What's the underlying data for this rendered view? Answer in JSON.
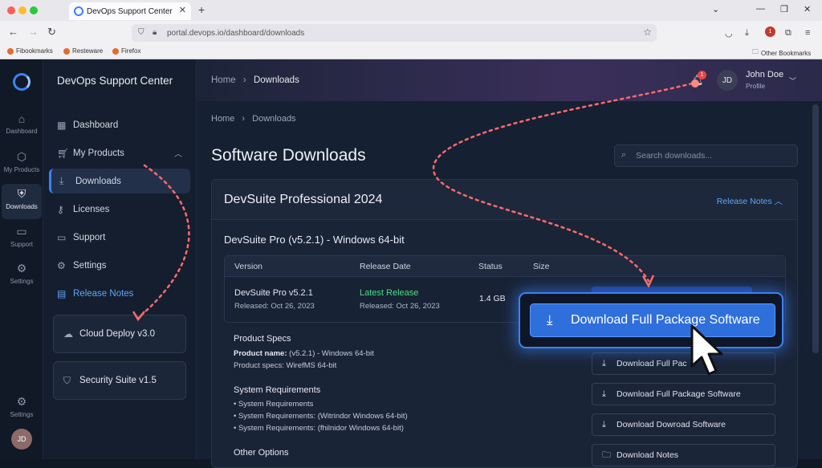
{
  "browser": {
    "tab_title": "DevOps Support Center",
    "url": "portal.devops.io/dashboard/downloads",
    "bookmarks": [
      "Fibookmarks",
      "Resteware",
      "Firefox"
    ],
    "other_bookmarks": "Other Bookmarks",
    "notif_count": "1"
  },
  "rail": {
    "items": [
      {
        "label": "Dashboard",
        "icon": "home-icon"
      },
      {
        "label": "My Products",
        "icon": "box-icon"
      },
      {
        "label": "Downloads",
        "icon": "shield-icon"
      },
      {
        "label": "Support",
        "icon": "chat-icon"
      },
      {
        "label": "Settings",
        "icon": "gear-icon"
      }
    ],
    "bottom_settings": "Settings",
    "avatar": "JD"
  },
  "sidebar": {
    "title": "DevOps Support Center",
    "items": [
      {
        "label": "Dashboard",
        "icon": "grid-icon"
      },
      {
        "label": "My Products",
        "icon": "cart-icon"
      },
      {
        "label": "Downloads",
        "icon": "download-icon"
      },
      {
        "label": "Licenses",
        "icon": "key-icon"
      },
      {
        "label": "Support",
        "icon": "chat-icon"
      },
      {
        "label": "Settings",
        "icon": "gear-icon"
      },
      {
        "label": "Release Notes",
        "icon": "notes-icon"
      }
    ],
    "cards": [
      {
        "label": "Cloud Deploy v3.0",
        "icon": "cloud-icon"
      },
      {
        "label": "Security Suite v1.5",
        "icon": "shield-icon"
      }
    ]
  },
  "header": {
    "crumb_home": "Home",
    "crumb_sep": "›",
    "crumb_current": "Downloads",
    "user_initials": "JD",
    "user_name": "John Doe",
    "user_sub": "Profile",
    "notif_count": "1"
  },
  "main": {
    "crumb_home": "Home",
    "crumb_sep": "›",
    "crumb_current": "Downloads",
    "title": "Software Downloads",
    "search_placeholder": "Search downloads...",
    "panel_title": "DevSuite Professional 2024",
    "release_notes": "Release Notes",
    "sub_title": "DevSuite Pro (v5.2.1) - Windows 64-bit",
    "table": {
      "headers": [
        "Version",
        "Release Date",
        "Status",
        "Size"
      ],
      "row": {
        "version": "DevSuite Pro v5.2.1",
        "version_sub": "Released: Oct 26, 2023",
        "status": "Latest Release",
        "status_sub": "Released: Oct 26, 2023",
        "size": "1.4 GB"
      }
    },
    "specs": {
      "heading": "Product Specs",
      "name_label": "Product name:",
      "name_value": " (v5.2.1) - Windows 64-bit",
      "specs_line": "Product specs: WirefMS 64-bit"
    },
    "requirements": {
      "heading": "System Requirements",
      "lines": [
        "• System Requirements",
        "• System Requirements: (Witrindor Windows 64-bit)",
        "• System Requirements: (fhilnidor Windows 64-bit)"
      ]
    },
    "other_options": "Other Options",
    "buttons": [
      "Download Full Pac",
      "Download Full Package Software",
      "Download Dowroad Software",
      "Download Notes"
    ],
    "primary_button": "Download Full Package Software"
  },
  "colors": {
    "accent": "#3b82f6",
    "success": "#4ade80",
    "badge": "#ef4444",
    "annotation": "#ff6b6b"
  }
}
